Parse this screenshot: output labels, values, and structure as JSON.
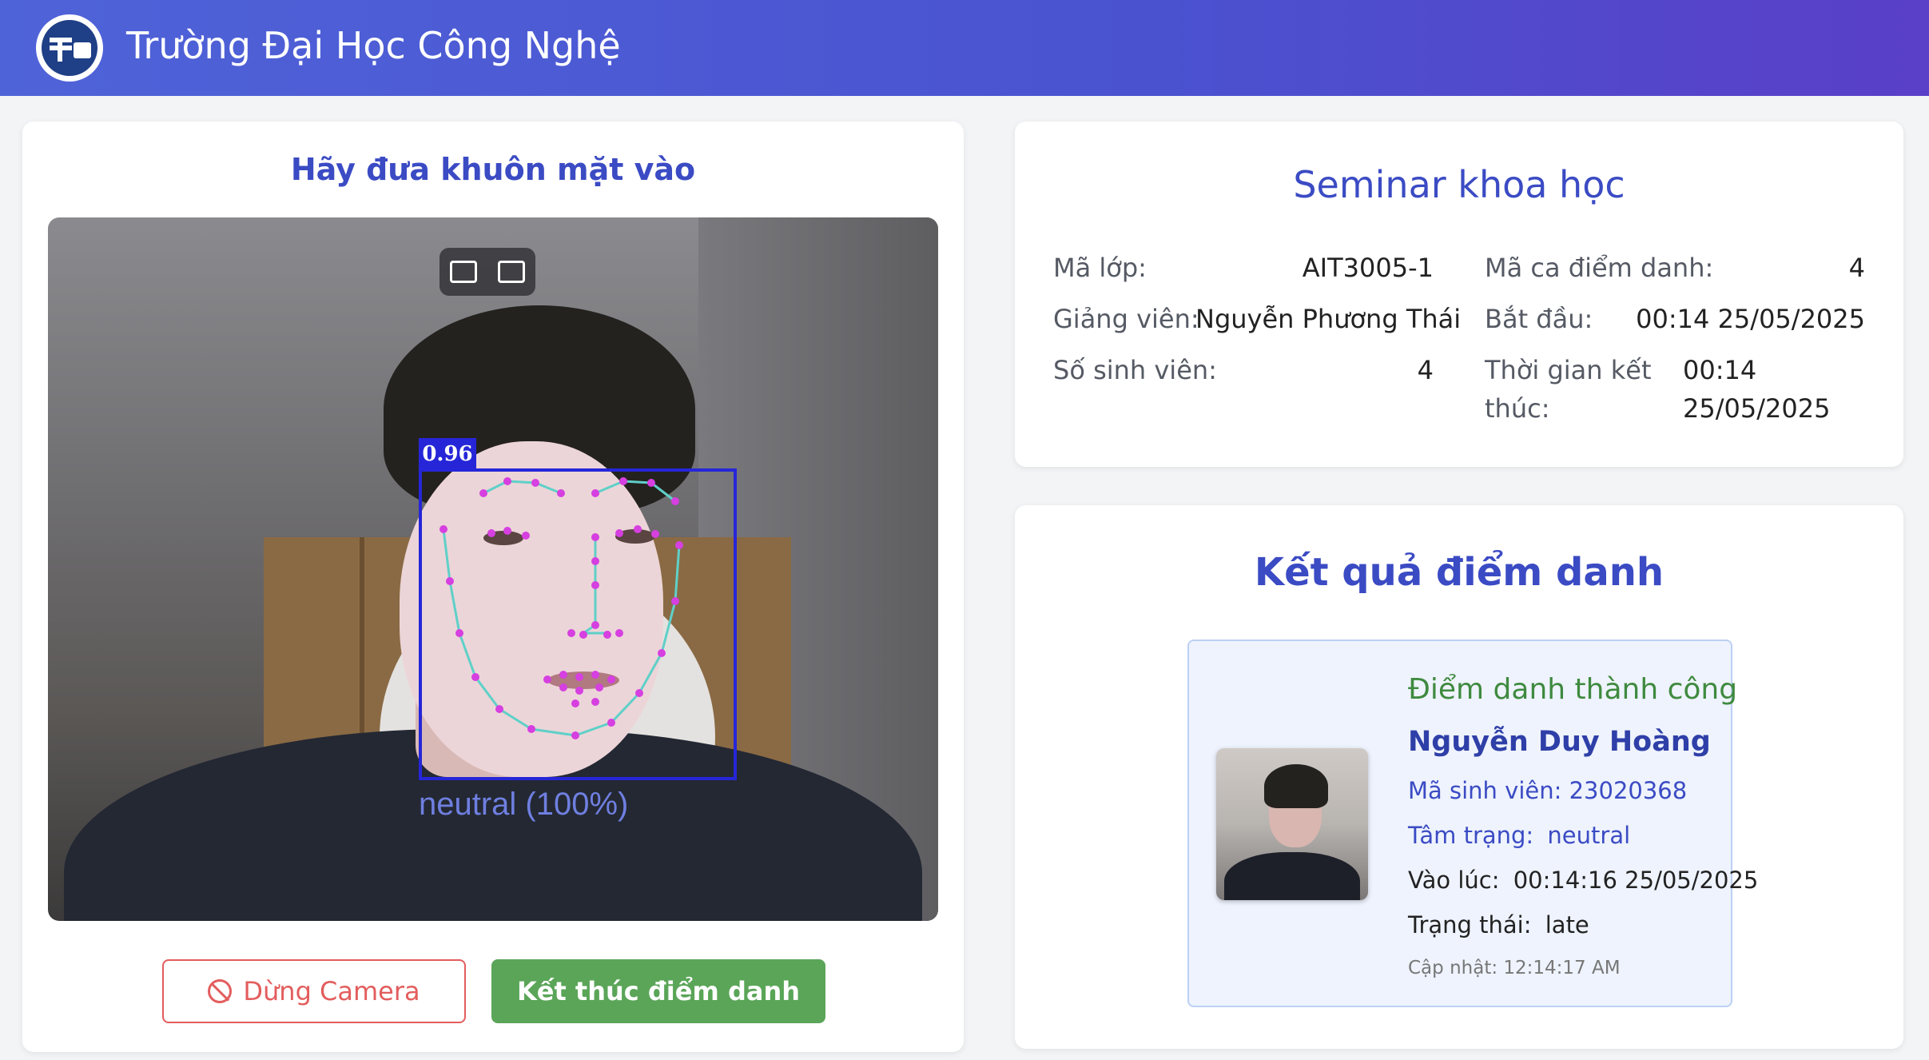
{
  "header": {
    "title": "Trường Đại Học Công Nghệ"
  },
  "camera": {
    "title": "Hãy đưa khuôn mặt vào",
    "detection_score": "0.96",
    "emotion_label": "neutral (100%)",
    "stop_button": "Dừng Camera",
    "end_button": "Kết thúc điểm danh"
  },
  "session": {
    "title": "Seminar khoa học",
    "class_code_label": "Mã lớp:",
    "class_code": "AIT3005-1",
    "lecturer_label": "Giảng viên:",
    "lecturer": "Nguyễn Phương Thái",
    "student_count_label": "Số sinh viên:",
    "student_count": "4",
    "session_id_label": "Mã ca điểm danh:",
    "session_id": "4",
    "start_label": "Bắt đầu:",
    "start": "00:14 25/05/2025",
    "end_label_1": "Thời gian kết",
    "end_label_2": "thúc:",
    "end_time": "00:14",
    "end_date": "25/05/2025"
  },
  "result": {
    "title": "Kết quả điểm danh",
    "status_msg": "Điểm danh thành công",
    "student_name": "Nguyễn Duy Hoàng",
    "student_id_label": "Mã sinh viên:",
    "student_id": "23020368",
    "mood_label": "Tâm trạng:",
    "mood": "neutral",
    "time_label": "Vào lúc:",
    "time": "00:14:16 25/05/2025",
    "state_label": "Trạng thái:",
    "state": "late",
    "updated": "Cập nhật: 12:14:17 AM"
  },
  "colors": {
    "accent": "#3b4bc4",
    "success": "#5aa558",
    "danger": "#e35d5d",
    "box": "#2626d8",
    "landmark": "#d63fe0"
  }
}
